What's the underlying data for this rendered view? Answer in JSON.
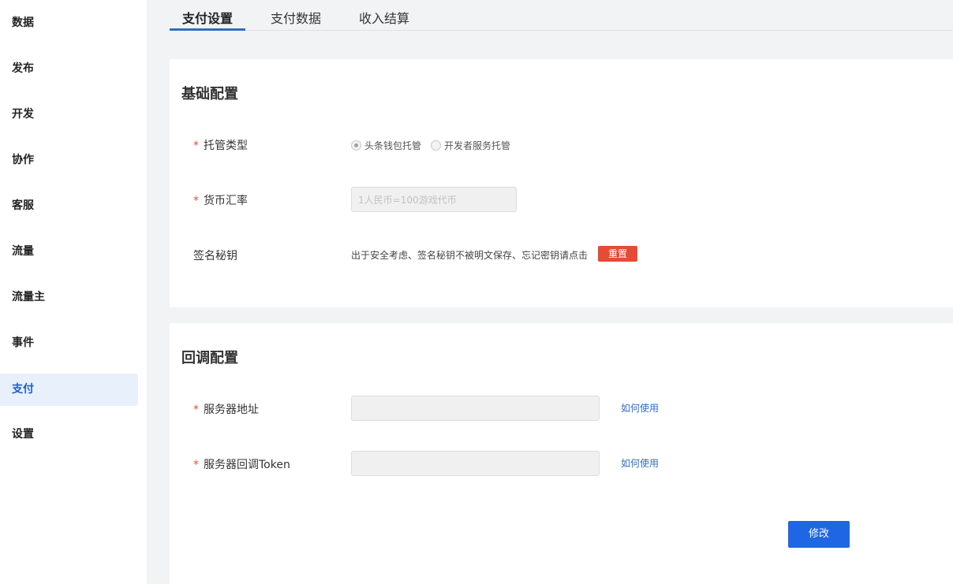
{
  "sidebar": {
    "items": [
      {
        "label": "数据"
      },
      {
        "label": "发布"
      },
      {
        "label": "开发"
      },
      {
        "label": "协作"
      },
      {
        "label": "客服"
      },
      {
        "label": "流量"
      },
      {
        "label": "流量主"
      },
      {
        "label": "事件"
      },
      {
        "label": "支付",
        "active": true
      },
      {
        "label": "设置"
      }
    ]
  },
  "tabs": [
    {
      "label": "支付设置",
      "active": true
    },
    {
      "label": "支付数据"
    },
    {
      "label": "收入结算"
    }
  ],
  "basic": {
    "title": "基础配置",
    "hosting_label": "托管类型",
    "hosting_options": [
      {
        "label": "头条钱包托管",
        "selected": true
      },
      {
        "label": "开发者服务托管",
        "selected": false
      }
    ],
    "rate_label": "货币汇率",
    "rate_placeholder": "1人民币=100游戏代币",
    "secret_label": "签名秘钥",
    "secret_hint": "出于安全考虑、签名秘钥不被明文保存、忘记密钥请点击",
    "reset_label": "重置"
  },
  "callback": {
    "title": "回调配置",
    "server_url_label": "服务器地址",
    "server_url_value": "",
    "server_token_label": "服务器回调Token",
    "server_token_value": "",
    "help_link": "如何使用",
    "submit_label": "修改"
  },
  "required_mark": "*",
  "colors": {
    "accent": "#1f66e5",
    "danger": "#e54b35",
    "active_nav_bg": "#e8f0fb"
  }
}
